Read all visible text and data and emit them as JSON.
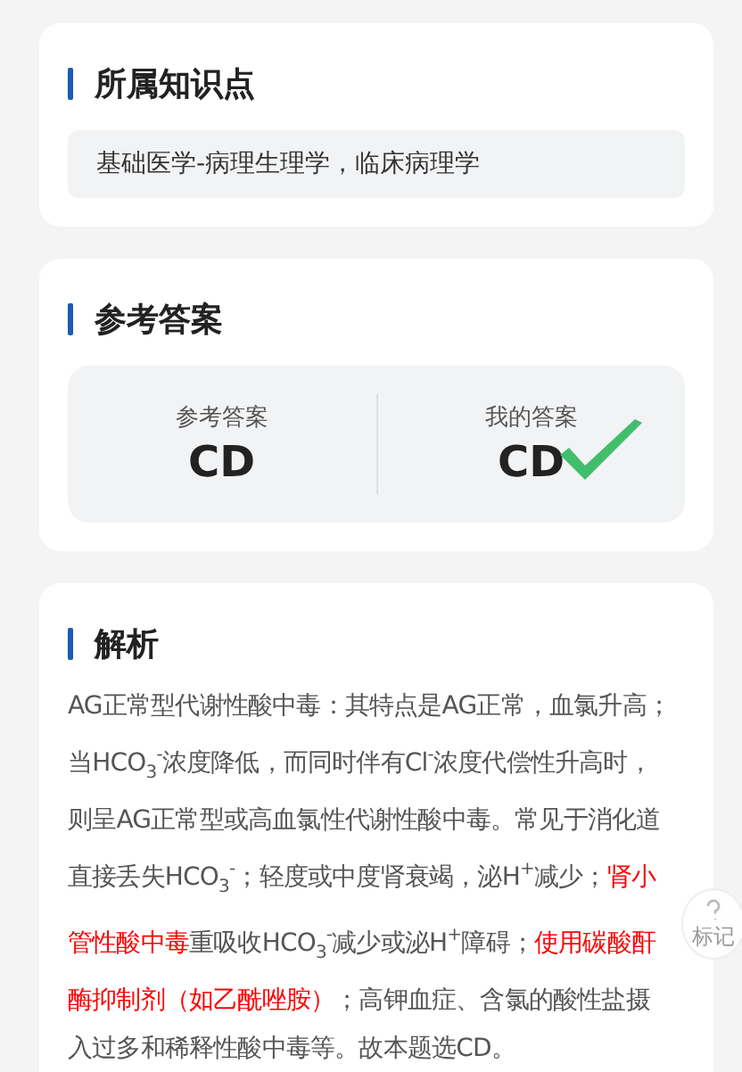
{
  "knowledge": {
    "title": "所属知识点",
    "tags": "基础医学-病理生理学，临床病理学"
  },
  "answer": {
    "title": "参考答案",
    "items": [
      {
        "label": "参考答案",
        "value": "CD",
        "correct": false
      },
      {
        "label": "我的答案",
        "value": "CD",
        "correct": true
      }
    ]
  },
  "analysis": {
    "title": "解析",
    "segments": [
      {
        "text": "AG正常型代谢性酸中毒：其特点是AG正常，血氯升高；当HCO$_{3}$$^{-}$浓度降低，而同时伴有Cl$^{-}$浓度代偿性升高时，则呈AG正常型或高血氯性代谢性酸中毒。常见于消化道直接丢失HCO$_{3}$$^{-}$；轻度或中度肾衰竭，泌H$^{+}$减少；",
        "highlight": false
      },
      {
        "text": "肾小管性酸中毒",
        "highlight": true
      },
      {
        "text": "重吸收HCO$_{3}$$^{-}$减少或泌H$^{+}$障碍；",
        "highlight": false
      },
      {
        "text": "使用碳酸酐酶抑制剂（如乙酰唑胺）",
        "highlight": true
      },
      {
        "text": "；高钾血症、含氯的酸性盐摄入过多和稀释性酸中毒等。故本题选CD。",
        "highlight": false
      }
    ]
  },
  "mark_button": {
    "label": "标记"
  }
}
